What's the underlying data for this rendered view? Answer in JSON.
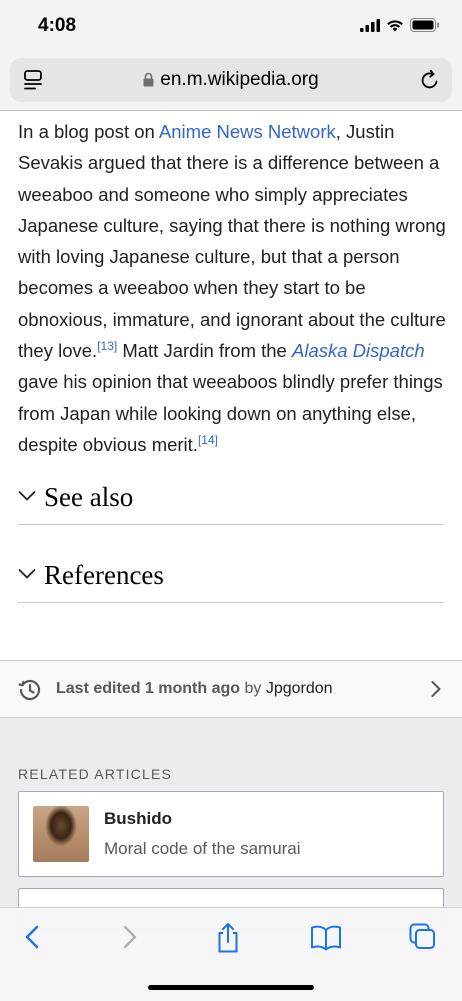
{
  "status": {
    "time": "4:08"
  },
  "address": {
    "url": "en.m.wikipedia.org"
  },
  "article": {
    "p1_a": "In a blog post on ",
    "p1_link": "Anime News Network",
    "p1_b": ", Justin Sevakis argued that there is a difference between a weeaboo and someone who simply appreciates Japanese culture, saying that there is nothing wrong with loving Japanese culture, but that a person becomes a weeaboo when they start to be obnoxious, immature, and ignorant about the culture they love.",
    "ref13": "[13]",
    "p1_c": " Matt Jardin from the ",
    "p1_link2": "Alaska Dispatch",
    "p1_d": " gave his opinion that weeaboos blindly prefer things from Japan while looking down on anything else, despite obvious merit.",
    "ref14": "[14]"
  },
  "sections": [
    {
      "title": "See also"
    },
    {
      "title": "References"
    }
  ],
  "last_edited": {
    "prefix": "Last edited 1 month ago",
    "by": " by ",
    "user": "Jpgordon"
  },
  "related": {
    "label": "RELATED ARTICLES",
    "items": [
      {
        "title": "Bushido",
        "description": "Moral code of the samurai"
      }
    ]
  },
  "toolbar": {
    "icons": [
      "back-icon",
      "forward-icon",
      "share-icon",
      "bookmarks-icon",
      "tabs-icon"
    ]
  }
}
